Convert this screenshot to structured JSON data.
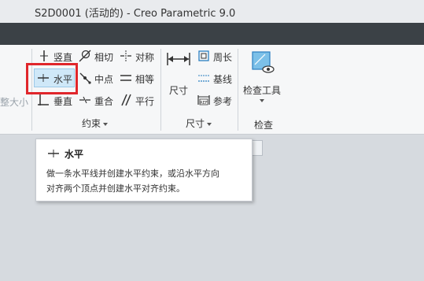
{
  "window": {
    "title": "S2D0001 (活动的) - Creo Parametric 9.0"
  },
  "ribbon": {
    "left_cut_label": "整大小",
    "constraints": {
      "vertical": "竖直",
      "horizontal": "水平",
      "perpendicular": "垂直",
      "tangent": "相切",
      "midpoint": "中点",
      "coincident": "重合",
      "symmetric": "对称",
      "equal": "相等",
      "parallel": "平行",
      "group_label": "约束"
    },
    "dimension": {
      "dimension": "尺寸",
      "perimeter": "周长",
      "baseline": "基线",
      "reference": "参考",
      "group_label": "尺寸"
    },
    "inspect": {
      "inspect_tools": "检查工具",
      "group_label": "检查"
    }
  },
  "tooltip": {
    "title": "水平",
    "line1": "做一条水平线并创建水平约束，或沿水平方向",
    "line2": "对齐两个顶点并创建水平对齐约束。"
  },
  "colors": {
    "highlight_border": "#e0262b",
    "selection_fill": "#cfe8f8",
    "ribbon_bg": "#f6f7f8",
    "tabstrip_bg": "#3b4146"
  }
}
